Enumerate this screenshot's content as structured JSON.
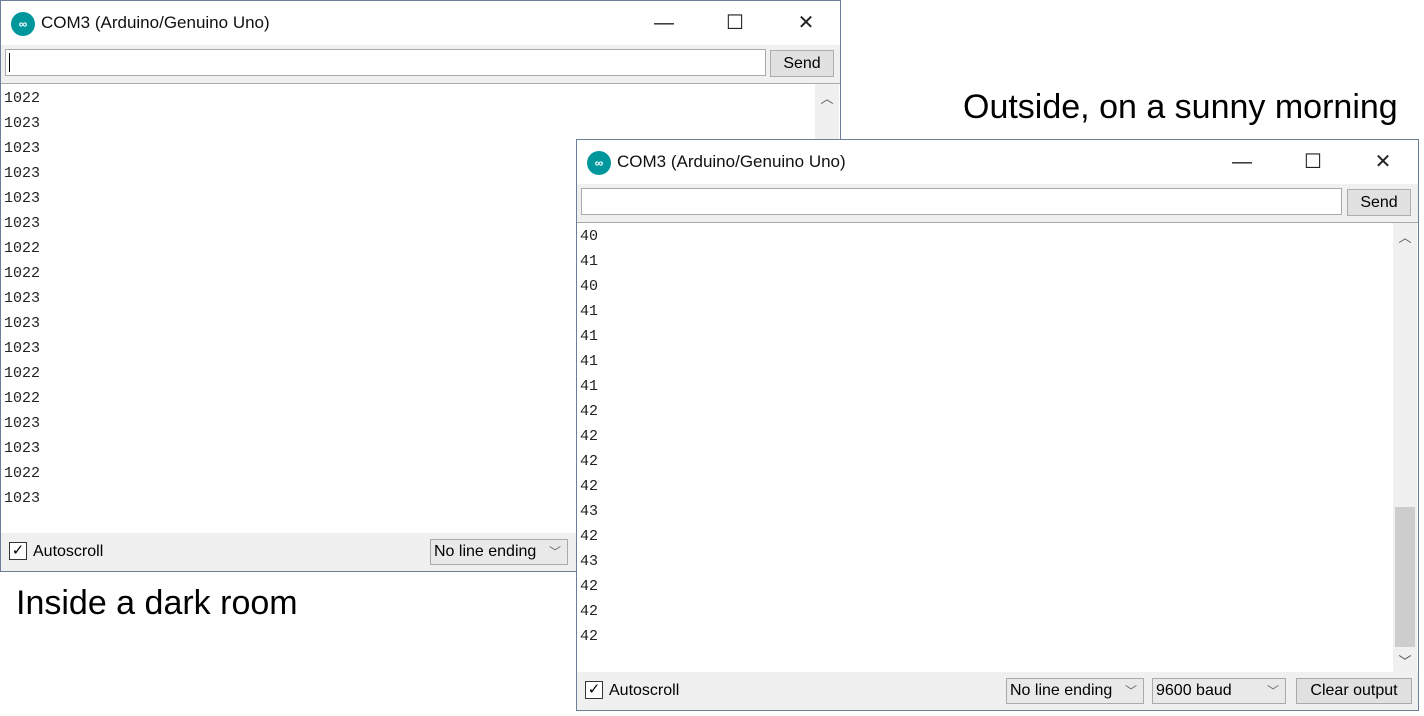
{
  "captions": {
    "outside": "Outside, on a sunny morning",
    "inside": "Inside a dark room"
  },
  "window_left": {
    "title": "COM3 (Arduino/Genuino Uno)",
    "input_value": "",
    "send_label": "Send",
    "lines": [
      "1022",
      "1023",
      "1023",
      "1023",
      "1023",
      "1023",
      "1022",
      "1022",
      "1023",
      "1023",
      "1023",
      "1022",
      "1022",
      "1023",
      "1023",
      "1022",
      "1023"
    ],
    "autoscroll_label": "Autoscroll",
    "autoscroll_checked": true,
    "line_ending": "No line ending"
  },
  "window_right": {
    "title": "COM3 (Arduino/Genuino Uno)",
    "input_value": "",
    "send_label": "Send",
    "lines": [
      "40",
      "41",
      "40",
      "41",
      "41",
      "41",
      "41",
      "42",
      "42",
      "42",
      "42",
      "43",
      "42",
      "43",
      "42",
      "42",
      "42"
    ],
    "autoscroll_label": "Autoscroll",
    "autoscroll_checked": true,
    "line_ending": "No line ending",
    "baud": "9600 baud",
    "clear_label": "Clear output"
  },
  "icons": {
    "logo": "arduino-logo",
    "minimize": "minimize-icon",
    "maximize": "maximize-icon",
    "close": "close-icon"
  },
  "accent": "#00979c"
}
